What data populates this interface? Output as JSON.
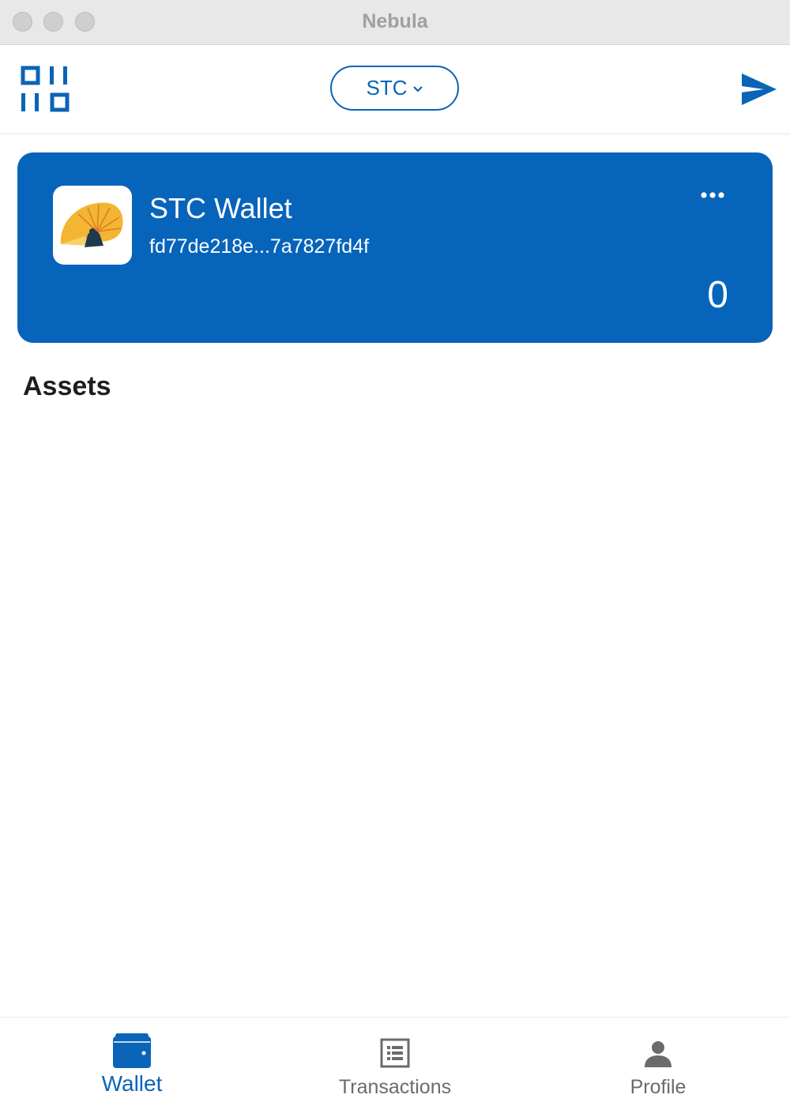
{
  "window": {
    "title": "Nebula"
  },
  "header": {
    "coin_selector": {
      "value": "STC",
      "icon": "chevron-down-icon"
    },
    "left_icon": "qr-scan-icon",
    "right_icon": "send-icon"
  },
  "wallet_card": {
    "name": "STC Wallet",
    "address": "fd77de218e...7a7827fd4f",
    "balance": "0",
    "menu_icon": "more-horizontal-icon",
    "logo_icon": "nautilus-shell-logo",
    "background_color": "#0764bb"
  },
  "assets": {
    "heading": "Assets",
    "items": []
  },
  "bottom_nav": {
    "items": [
      {
        "label": "Wallet",
        "icon": "wallet-icon",
        "active": true
      },
      {
        "label": "Transactions",
        "icon": "transactions-list-icon",
        "active": false
      },
      {
        "label": "Profile",
        "icon": "profile-icon",
        "active": false
      }
    ]
  },
  "colors": {
    "accent": "#0a64b8",
    "card": "#0764bb",
    "inactive": "#6b6b6b"
  }
}
